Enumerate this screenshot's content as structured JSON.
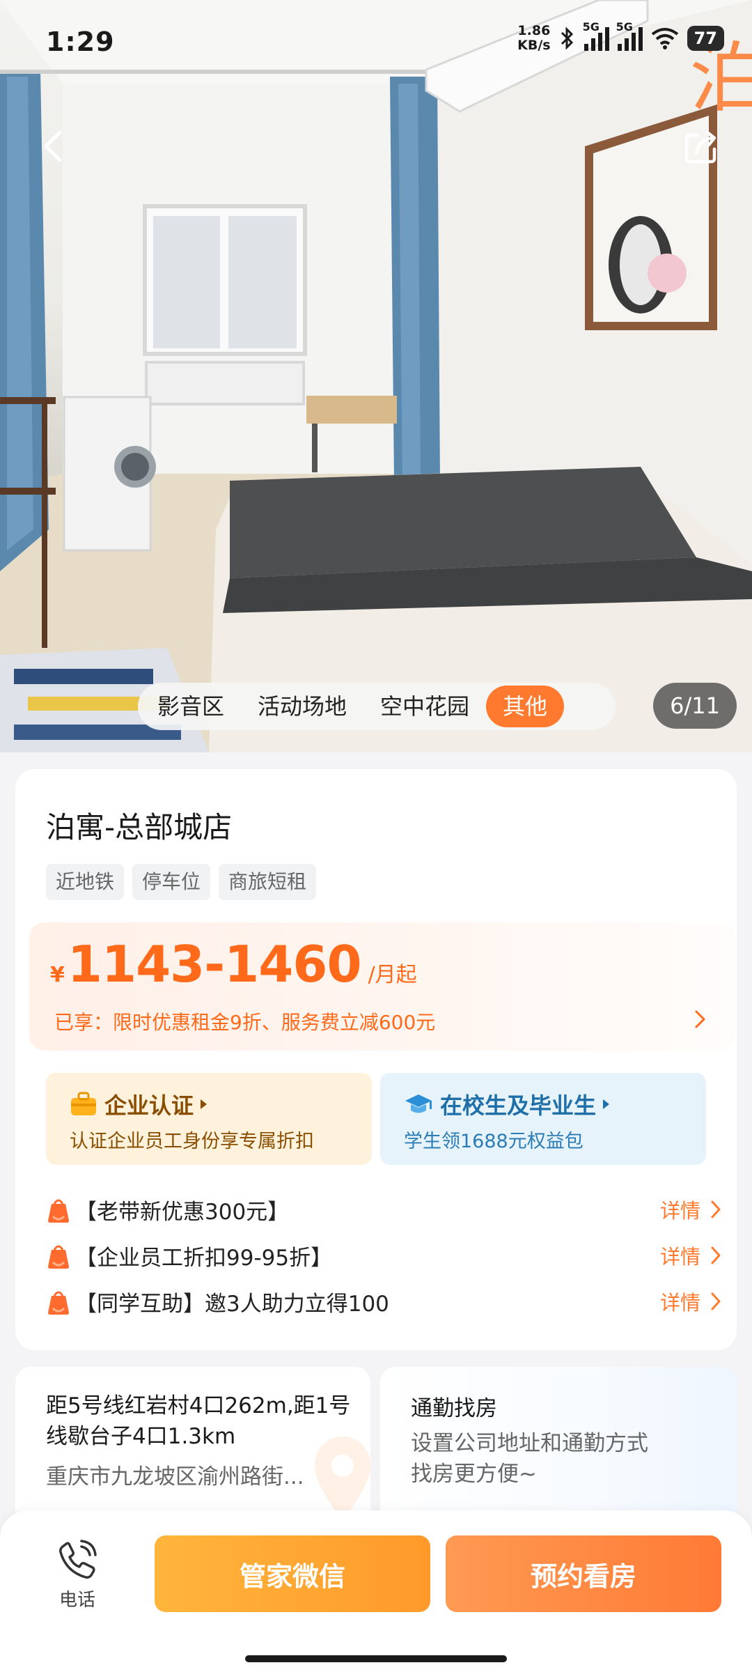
{
  "status_bar": {
    "time": "1:29",
    "net_speed_value": "1.86",
    "net_speed_unit": "KB/s",
    "sim1": "5G",
    "sim2": "5G",
    "battery": "77"
  },
  "hero": {
    "categories": [
      "影音区",
      "活动场地",
      "空中花园",
      "其他"
    ],
    "active_category": "其他",
    "photo_counter": "6/11",
    "icons": {
      "back": "chevron-left-icon",
      "share": "share-icon"
    }
  },
  "listing": {
    "title": "泊寓-总部城店",
    "tags": [
      "近地铁",
      "停车位",
      "商旅短租"
    ],
    "price": {
      "currency": "¥",
      "range": "1143-1460",
      "unit": "/月起",
      "discount": "已享：限时优惠租金9折、服务费立减600元"
    },
    "promos": {
      "enterprise": {
        "title": "企业认证",
        "subtitle": "认证企业员工身份享专属折扣"
      },
      "student": {
        "title": "在校生及毕业生",
        "subtitle": "学生领1688元权益包"
      }
    },
    "offers": [
      {
        "text": "【老带新优惠300元】",
        "link": "详情"
      },
      {
        "text": "【企业员工折扣99-95折】",
        "link": "详情"
      },
      {
        "text": "【同学互助】邀3人助力立得100",
        "link": "详情"
      }
    ]
  },
  "location": {
    "distance": "距5号线红岩村4口262m,距1号线歇台子4口1.3km",
    "address": "重庆市九龙坡区渝州路街..."
  },
  "commute": {
    "title": "通勤找房",
    "desc_line1": "设置公司地址和通勤方式",
    "desc_line2": "找房更方便~"
  },
  "bottom_bar": {
    "call_label": "电话",
    "wechat_button": "管家微信",
    "book_button": "预约看房"
  },
  "colors": {
    "accent_orange": "#ff7a2e",
    "price_orange": "#ff6a1a",
    "enterprise_brown": "#8a4e00",
    "student_blue": "#1e6fa8"
  }
}
